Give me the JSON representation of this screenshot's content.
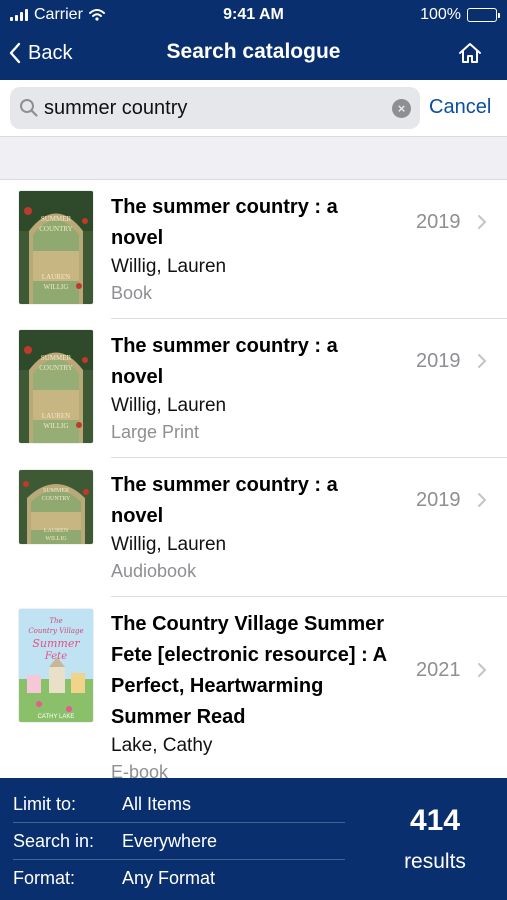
{
  "status_bar": {
    "carrier": "Carrier",
    "time": "9:41 AM",
    "battery": "100%",
    "icons": [
      "signal-icon",
      "wifi-icon",
      "battery-icon"
    ]
  },
  "nav": {
    "back_label": "Back",
    "title": "Search catalogue",
    "home_icon": "home-icon"
  },
  "search": {
    "value": "summer country",
    "placeholder": "",
    "cancel_label": "Cancel"
  },
  "results": [
    {
      "title_line1": "The summer country : a",
      "title_line2": "novel",
      "author": "Willig, Lauren",
      "format": "Book",
      "year": "2019",
      "cover_lines": [
        "THE",
        "SUMMER",
        "COUNTRY",
        "LAUREN",
        "WILLIG"
      ]
    },
    {
      "title_line1": "The summer country : a",
      "title_line2": "novel",
      "author": "Willig, Lauren",
      "format": "Large Print",
      "year": "2019",
      "cover_lines": [
        "THE",
        "SUMMER",
        "COUNTRY",
        "LAUREN",
        "WILLIG"
      ]
    },
    {
      "title_line1": "The summer country : a",
      "title_line2": "novel",
      "author": "Willig, Lauren",
      "format": "Audiobook",
      "year": "2019",
      "cover_lines": [
        "THE",
        "SUMMER",
        "COUNTRY",
        "LAUREN",
        "WILLIG"
      ]
    },
    {
      "title_line1": "The Country Village Summer",
      "title_line2": "Fete [electronic resource] : A",
      "title_line3": "Perfect, Heartwarming",
      "title_line4": "Summer Read",
      "author": "Lake, Cathy",
      "format": "E-book",
      "year": "2021",
      "cover_lines": [
        "The",
        "Country Village",
        "Summer",
        "Fete",
        "CATHY LAKE"
      ]
    }
  ],
  "footer": {
    "filters": [
      {
        "label": "Limit to:",
        "value": "All Items"
      },
      {
        "label": "Search in:",
        "value": "Everywhere"
      },
      {
        "label": "Format:",
        "value": "Any Format"
      }
    ],
    "count": "414",
    "count_label": "results"
  },
  "colors": {
    "header_bg": "#0a2f6e",
    "link": "#0a4fa0",
    "muted": "#8e8e93",
    "search_bg": "#e6e7eb",
    "list_bg": "#efeff4"
  }
}
